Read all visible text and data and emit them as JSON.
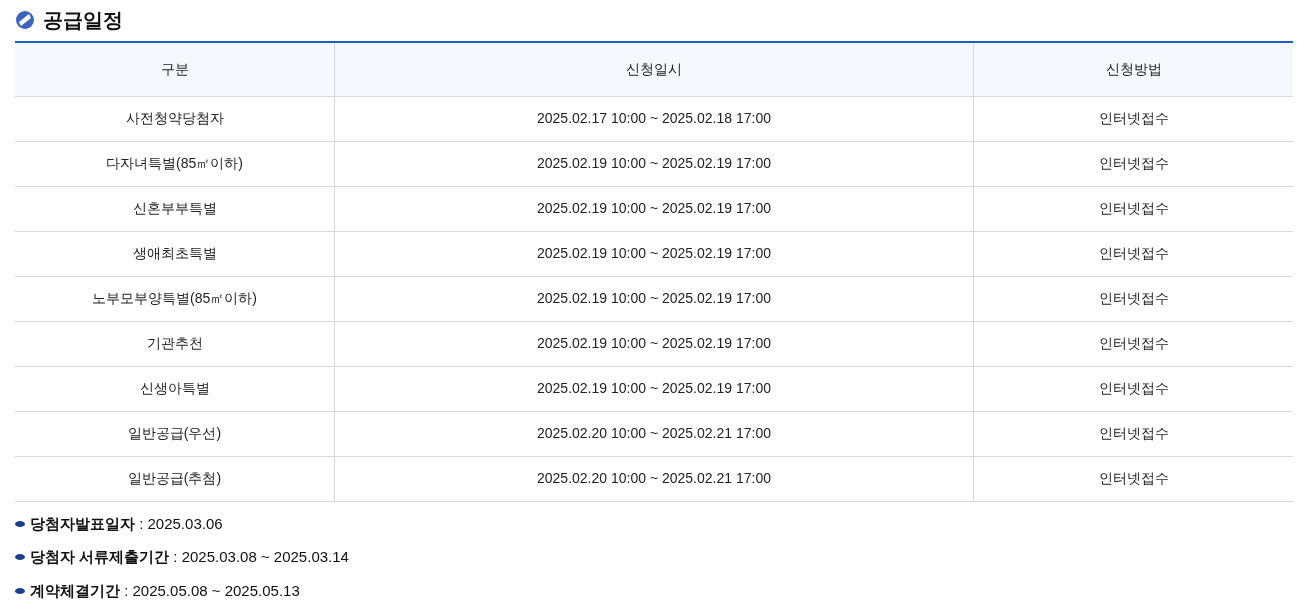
{
  "title": "공급일정",
  "table": {
    "columns": [
      "구분",
      "신청일시",
      "신청방법"
    ],
    "rows": [
      [
        "사전청약당첨자",
        "2025.02.17 10:00 ~ 2025.02.18 17:00",
        "인터넷접수"
      ],
      [
        "다자녀특별(85㎡이하)",
        "2025.02.19 10:00 ~ 2025.02.19 17:00",
        "인터넷접수"
      ],
      [
        "신혼부부특별",
        "2025.02.19 10:00 ~ 2025.02.19 17:00",
        "인터넷접수"
      ],
      [
        "생애최초특별",
        "2025.02.19 10:00 ~ 2025.02.19 17:00",
        "인터넷접수"
      ],
      [
        "노부모부양특별(85㎡이하)",
        "2025.02.19 10:00 ~ 2025.02.19 17:00",
        "인터넷접수"
      ],
      [
        "기관추천",
        "2025.02.19 10:00 ~ 2025.02.19 17:00",
        "인터넷접수"
      ],
      [
        "신생아특별",
        "2025.02.19 10:00 ~ 2025.02.19 17:00",
        "인터넷접수"
      ],
      [
        "일반공급(우선)",
        "2025.02.20 10:00 ~ 2025.02.21 17:00",
        "인터넷접수"
      ],
      [
        "일반공급(추첨)",
        "2025.02.20 10:00 ~ 2025.02.21 17:00",
        "인터넷접수"
      ]
    ]
  },
  "notes": [
    "**당첨자발표일자** : 2025.03.06",
    "**당첨자 서류제출기간** : 2025.03.08 ~ 2025.03.14",
    "**계약체결기간** : 2025.05.08 ~ 2025.05.13"
  ]
}
